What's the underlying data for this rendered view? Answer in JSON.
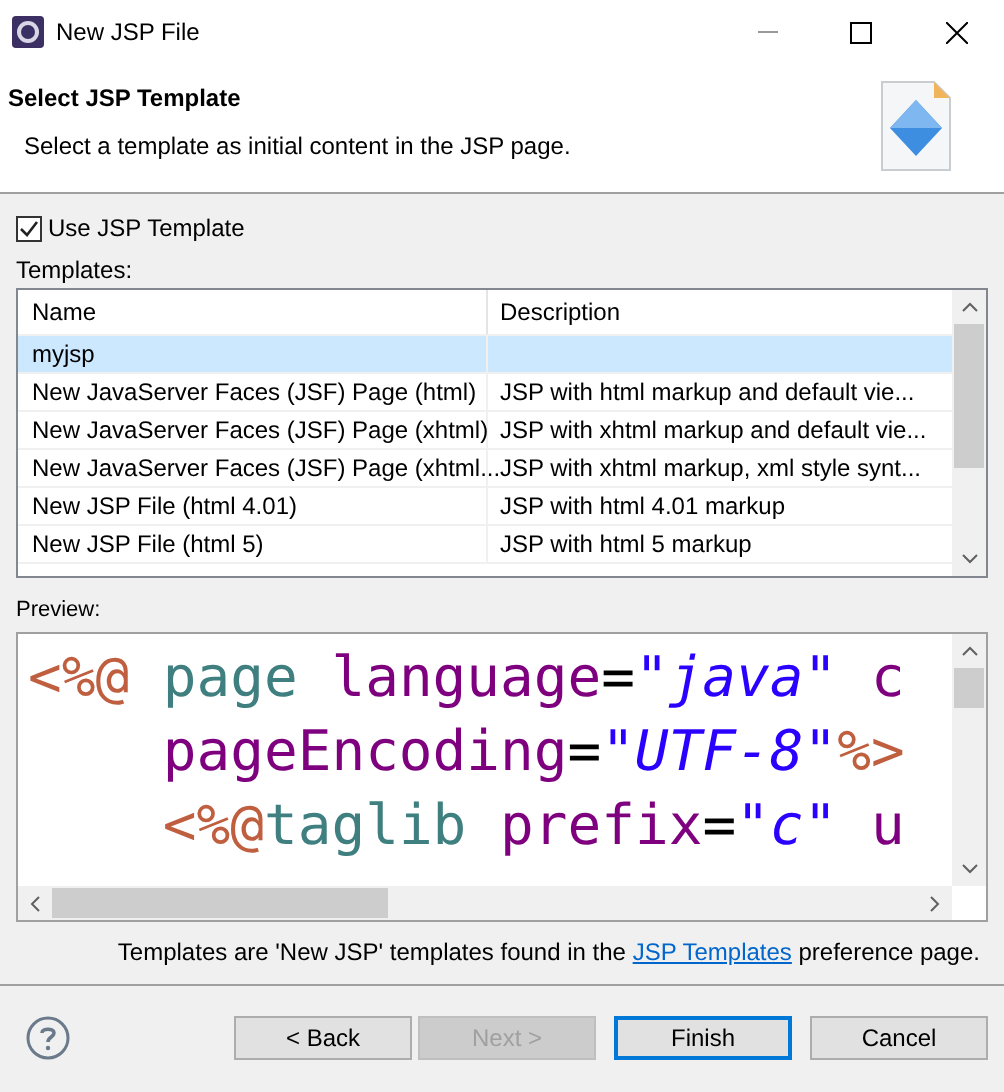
{
  "window": {
    "title": "New JSP File"
  },
  "header": {
    "title": "Select JSP Template",
    "description": "Select a template as initial content in the JSP page."
  },
  "use_template": {
    "label": "Use JSP Template",
    "checked": true
  },
  "templates_label": "Templates:",
  "table": {
    "columns": [
      "Name",
      "Description"
    ],
    "rows": [
      {
        "name": "myjsp",
        "description": "",
        "selected": true
      },
      {
        "name": "New JavaServer Faces (JSF) Page (html)",
        "description": "JSP with html markup and default vie...",
        "selected": false
      },
      {
        "name": "New JavaServer Faces (JSF) Page (xhtml)",
        "description": "JSP with xhtml markup and default vie...",
        "selected": false
      },
      {
        "name": "New JavaServer Faces (JSF) Page (xhtml...",
        "description": "JSP with xhtml markup, xml style synt...",
        "selected": false
      },
      {
        "name": "New JSP File (html 4.01)",
        "description": "JSP with html 4.01 markup",
        "selected": false
      },
      {
        "name": "New JSP File (html 5)",
        "description": "JSP with html 5 markup",
        "selected": false
      }
    ]
  },
  "preview_label": "Preview:",
  "preview": [
    [
      {
        "kind": "delim",
        "text": "<%@"
      },
      {
        "kind": "directive",
        "text": " page"
      },
      {
        "kind": "attr",
        "text": " language"
      },
      {
        "kind": "eq",
        "text": "="
      },
      {
        "kind": "value",
        "text": "\"java\""
      },
      {
        "kind": "attr",
        "text": " c"
      }
    ],
    [
      {
        "kind": "attr",
        "text": "    pageEncoding"
      },
      {
        "kind": "eq",
        "text": "="
      },
      {
        "kind": "value",
        "text": "\"UTF-8\""
      },
      {
        "kind": "delim",
        "text": "%>"
      }
    ],
    [
      {
        "kind": "delim",
        "text": "    <%@"
      },
      {
        "kind": "directive",
        "text": "taglib"
      },
      {
        "kind": "attr",
        "text": " prefix"
      },
      {
        "kind": "eq",
        "text": "="
      },
      {
        "kind": "value",
        "text": "\"c\""
      },
      {
        "kind": "attr",
        "text": " u"
      }
    ]
  ],
  "note": {
    "before": "Templates are 'New JSP' templates found in the ",
    "link": "JSP Templates",
    "after": " preference page."
  },
  "buttons": [
    {
      "label": "< Back",
      "disabled": false,
      "default": false
    },
    {
      "label": "Next >",
      "disabled": true,
      "default": false
    },
    {
      "label": "Finish",
      "disabled": false,
      "default": true
    },
    {
      "label": "Cancel",
      "disabled": false,
      "default": false
    }
  ]
}
